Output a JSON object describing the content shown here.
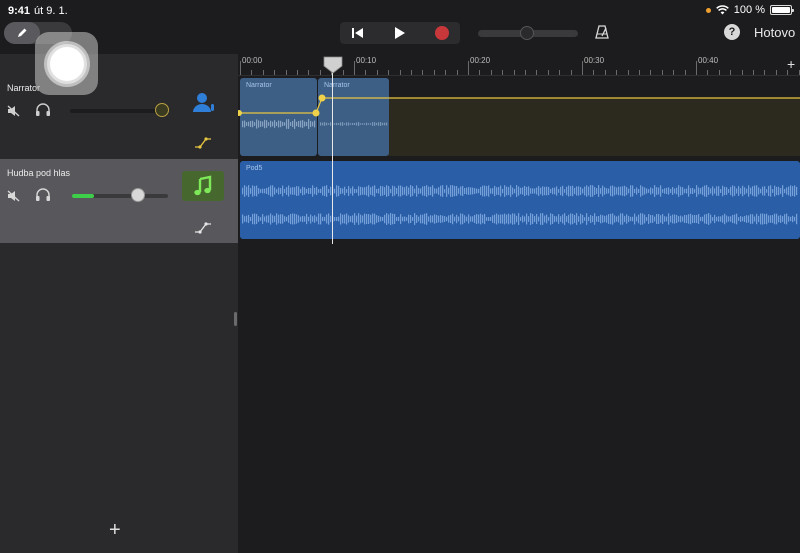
{
  "status": {
    "time": "9:41",
    "date": "út 9. 1.",
    "battery": "100 %"
  },
  "toolbar": {
    "done_label": "Hotovo",
    "help_label": "?",
    "transport": {
      "go_to_start_icon": "skip-back-icon",
      "play_icon": "play-icon",
      "record_icon": "record-icon"
    },
    "record_color": "#c8383a",
    "metronome_icon": "metronome-icon"
  },
  "tracks": [
    {
      "name": "Narrator",
      "instrument_icon": "voice-user-icon",
      "volume": 0.88,
      "selected": false
    },
    {
      "name": "Hudba pod hlas",
      "instrument_icon": "music-note-icon",
      "volume": 0.62,
      "selected": true
    }
  ],
  "add_track_label": "+",
  "ruler": {
    "labels": [
      "00:00",
      "00:10",
      "00:20",
      "00:30",
      "00:40"
    ],
    "add_label": "+"
  },
  "regions": {
    "track1": [
      {
        "label": "Narrator"
      },
      {
        "label": "Narrator"
      }
    ],
    "track2": [
      {
        "label": "Pod5"
      }
    ]
  },
  "colors": {
    "region_blue": "#2a5fa8",
    "region_audio_pale": "#3d5f86",
    "automation_yellow": "#f0d24a",
    "selected_header": "#58585c",
    "music_icon_bg": "#46682f",
    "volume_green": "#3ecf4a"
  }
}
